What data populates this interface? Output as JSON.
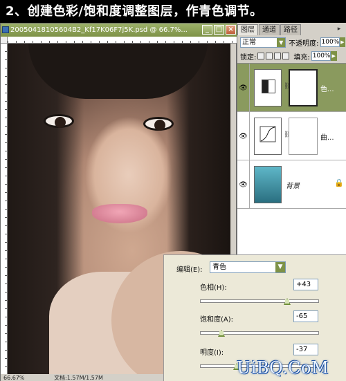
{
  "step_title": "2、创建色彩/饱和度调整图层，作青色调节。",
  "document": {
    "title": "20050418105604B2_Kf17K06F7j5K.psd @ 66.7%...",
    "zoom": "66.67%",
    "status": "文档:1.57M/1.57M"
  },
  "layers_panel": {
    "tabs": [
      "图层",
      "通道",
      "路径"
    ],
    "blend_mode": "正常",
    "opacity_label": "不透明度:",
    "opacity_value": "100%",
    "lock_label": "锁定:",
    "fill_label": "填充:",
    "fill_value": "100%",
    "layers": [
      {
        "name": "色...",
        "type": "hue-saturation-adjustment",
        "selected": true
      },
      {
        "name": "曲...",
        "type": "curves-adjustment",
        "selected": false
      },
      {
        "name": "背景",
        "type": "background",
        "selected": false
      }
    ]
  },
  "hue_dialog": {
    "edit_label": "编辑(E):",
    "edit_value": "青色",
    "hue_label": "色相(H):",
    "hue_value": "+43",
    "saturation_label": "饱和度(A):",
    "saturation_value": "-65",
    "lightness_label": "明度(I):",
    "lightness_value": "-37"
  },
  "watermark": "UiBQ.CoM",
  "colors": {
    "titlebar": "#8a9a5e",
    "accent": "#7e9247"
  }
}
